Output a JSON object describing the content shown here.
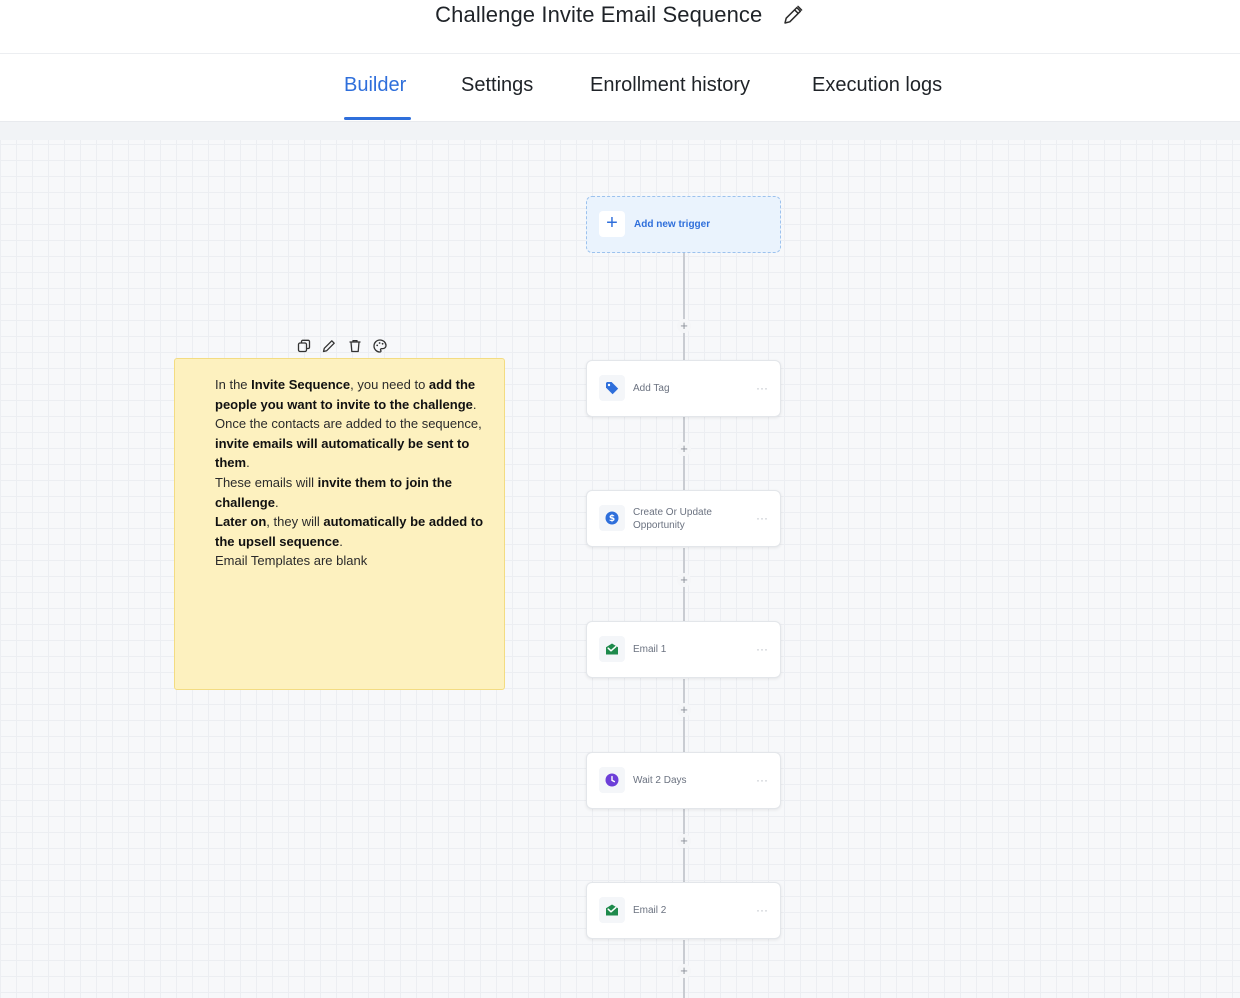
{
  "header": {
    "title": "Challenge Invite Email Sequence"
  },
  "tabs": [
    {
      "label": "Builder",
      "active": true
    },
    {
      "label": "Settings",
      "active": false
    },
    {
      "label": "Enrollment history",
      "active": false
    },
    {
      "label": "Execution logs",
      "active": false
    }
  ],
  "colors": {
    "accent": "#2f6fdb",
    "note_bg": "#fdf1bf"
  },
  "note": {
    "tools": [
      "copy-icon",
      "pencil-icon",
      "trash-icon",
      "palette-icon"
    ],
    "p1_a": "In the ",
    "p1_b": "Invite Sequence",
    "p1_c": ", you need to ",
    "p1_d": "add the people you want to invite to the challenge",
    "p1_e": ".",
    "p2_a": "Once the contacts are added to the sequence, ",
    "p2_b": "invite emails will automatically be sent to them",
    "p2_c": ".",
    "p3_a": "These emails will ",
    "p3_b": "invite them to join the challenge",
    "p3_c": ".",
    "p4_a": "Later on",
    "p4_b": ", they will ",
    "p4_c": "automatically be added to the upsell sequence",
    "p4_d": ".",
    "p5": "Email Templates are blank"
  },
  "flow": {
    "trigger_label": "Add new trigger",
    "nodes": [
      {
        "label": "Add Tag",
        "icon": "tag-icon",
        "color": "#2f6fdb"
      },
      {
        "label": "Create Or Update Opportunity",
        "icon": "dollar-icon",
        "color": "#2f6fdb"
      },
      {
        "label": "Email 1",
        "icon": "email-icon",
        "color": "#1e8a4c"
      },
      {
        "label": "Wait 2 Days",
        "icon": "clock-icon",
        "color": "#6d3fd8"
      },
      {
        "label": "Email 2",
        "icon": "email-icon",
        "color": "#1e8a4c"
      }
    ],
    "more_label": "···",
    "add_label": "+"
  }
}
